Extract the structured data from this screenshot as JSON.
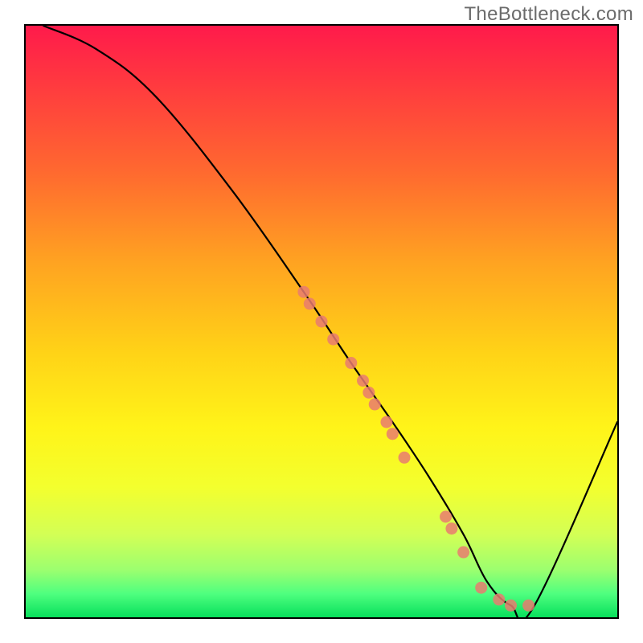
{
  "watermark": "TheBottleneck.com",
  "chart_data": {
    "type": "line",
    "title": "",
    "xlabel": "",
    "ylabel": "",
    "xlim": [
      0,
      100
    ],
    "ylim": [
      0,
      100
    ],
    "grid": false,
    "legend": false,
    "series": [
      {
        "name": "curve",
        "x": [
          3,
          12,
          22,
          35,
          47,
          55,
          62,
          68,
          74,
          78,
          82,
          86,
          100
        ],
        "y": [
          100,
          96,
          88,
          72,
          55,
          43,
          33,
          24,
          14,
          6,
          2,
          2,
          33
        ]
      }
    ],
    "highlight_points": {
      "name": "markers",
      "x": [
        47,
        48,
        50,
        52,
        55,
        57,
        58,
        59,
        61,
        62,
        64,
        71,
        72,
        74,
        77,
        80,
        82,
        85
      ],
      "y": [
        55,
        53,
        50,
        47,
        43,
        40,
        38,
        36,
        33,
        31,
        27,
        17,
        15,
        11,
        5,
        3,
        2,
        2
      ],
      "color": "#e97b70"
    },
    "gradient_stops": [
      {
        "pos": 0,
        "color": "#ff1a4b"
      },
      {
        "pos": 10,
        "color": "#ff3a3f"
      },
      {
        "pos": 25,
        "color": "#ff6a2f"
      },
      {
        "pos": 40,
        "color": "#ffa321"
      },
      {
        "pos": 55,
        "color": "#ffd217"
      },
      {
        "pos": 68,
        "color": "#fff419"
      },
      {
        "pos": 78,
        "color": "#f3ff2e"
      },
      {
        "pos": 86,
        "color": "#d3ff55"
      },
      {
        "pos": 92,
        "color": "#9cff6f"
      },
      {
        "pos": 96,
        "color": "#4fff7f"
      },
      {
        "pos": 100,
        "color": "#08e05c"
      }
    ]
  }
}
